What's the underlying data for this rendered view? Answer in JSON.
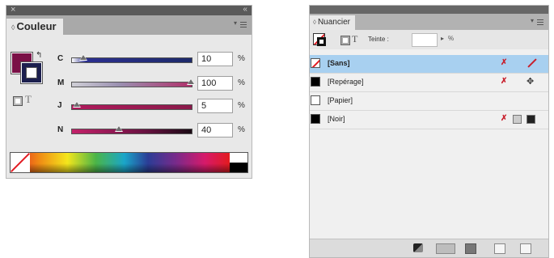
{
  "couleur": {
    "close_glyph": "×",
    "collapse_glyph": "‹‹",
    "tab_grip": "◊",
    "tab_label": "Couleur",
    "swap_glyph": "↰",
    "text_glyph": "T",
    "menu_glyph": "▾≡",
    "rows": [
      {
        "label": "C",
        "value": "10",
        "unit": "%",
        "level": 0.1,
        "gradient": "linear-gradient(to right,#ffffff,#2b2f8f 12%,#1d2a6a 100%)"
      },
      {
        "label": "M",
        "value": "100",
        "unit": "%",
        "level": 1.0,
        "gradient": "linear-gradient(to right,#cfcfd6 0%,#9a8fb0 40%,#b0306a 100%)"
      },
      {
        "label": "J",
        "value": "5",
        "unit": "%",
        "level": 0.05,
        "gradient": "linear-gradient(to right,#b01a5c,#8a1a4a)"
      },
      {
        "label": "N",
        "value": "40",
        "unit": "%",
        "level": 0.4,
        "gradient": "linear-gradient(to right,#c4226a 0%,#6a1242 60%,#1a0a14 100%)"
      }
    ],
    "fill_color": "#7a1046",
    "stroke_color": "#1c1f4e"
  },
  "nuancier": {
    "tab_grip": "◊",
    "tab_label": "Nuancier",
    "menu_glyph": "▾≡",
    "teinte_label": "Teinte :",
    "teinte_value": "",
    "teinte_arrow": "▸",
    "teinte_unit": "%",
    "swatches": [
      {
        "name": "[Sans]",
        "chip": "none",
        "selected": true,
        "icons": [
          "lock-icon",
          "no-color-icon"
        ]
      },
      {
        "name": "[Repérage]",
        "chip": "#000000",
        "selected": false,
        "icons": [
          "lock-icon",
          "registration-icon"
        ]
      },
      {
        "name": "[Papier]",
        "chip": "#ffffff",
        "selected": false,
        "icons": []
      },
      {
        "name": "[Noir]",
        "chip": "#000000",
        "selected": false,
        "icons": [
          "lock-icon",
          "gray-mode-icon",
          "cmyk-icon"
        ]
      }
    ],
    "lock_glyph": "✗",
    "registration_glyph": "✥"
  }
}
